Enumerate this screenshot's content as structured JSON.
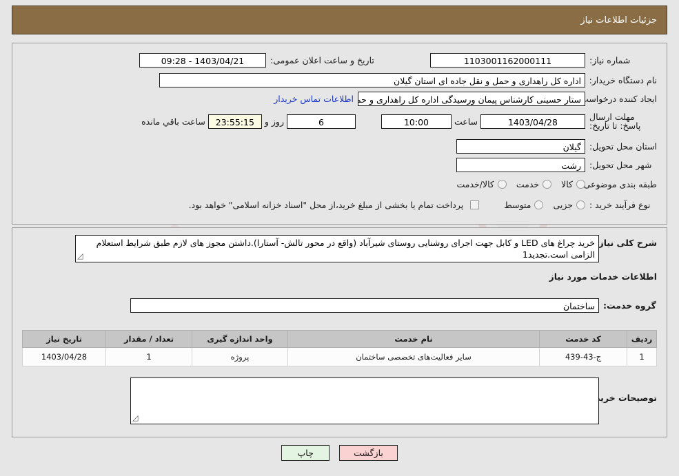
{
  "header": {
    "title": "جزئیات اطلاعات نیاز"
  },
  "watermark": {
    "text": "AriaTender.net"
  },
  "form": {
    "need_number": {
      "label": "شماره نیاز:",
      "value": "1103001162000111"
    },
    "announce_datetime": {
      "label": "تاریخ و ساعت اعلان عمومی:",
      "value": "1403/04/21 - 09:28"
    },
    "buyer_org": {
      "label": "نام دستگاه خریدار:",
      "value": "اداره کل راهداری و حمل و نقل جاده ای استان گیلان"
    },
    "requester": {
      "label": "ایجاد کننده درخواست:",
      "value": "ستار حسینی کارشناس پیمان ورسیدگی اداره کل راهداری و حمل و نقل جاده ای",
      "contact_link": "اطلاعات تماس خریدار"
    },
    "deadline": {
      "label": "مهلت ارسال پاسخ: تا تاریخ:",
      "date": "1403/04/28",
      "time_label": "ساعت",
      "time": "10:00",
      "days": "6",
      "days_label": "روز و",
      "countdown": "23:55:15",
      "countdown_label": "ساعت باقي مانده"
    },
    "delivery_province": {
      "label": "استان محل تحویل:",
      "value": "گیلان"
    },
    "delivery_city": {
      "label": "شهر محل تحویل:",
      "value": "رشت"
    },
    "subject_class": {
      "label": "طبقه بندی موضوعی:",
      "options": [
        {
          "label": "کالا",
          "selected": false
        },
        {
          "label": "خدمت",
          "selected": false
        },
        {
          "label": "کالا/خدمت",
          "selected": false
        }
      ]
    },
    "process_type": {
      "label": "نوع فرآیند خرید :",
      "options": [
        {
          "label": "جزیی",
          "selected": false
        },
        {
          "label": "متوسط",
          "selected": false
        }
      ],
      "treasury_checkbox": {
        "checked": false
      },
      "treasury_text": "پرداخت تمام یا بخشی از مبلغ خرید،از محل \"اسناد خزانه اسلامی\" خواهد بود."
    }
  },
  "description": {
    "label": "شرح کلی نیاز:",
    "value": "خرید چراغ های  LED و کابل جهت اجرای روشنایی روستای شیرآباد (واقع در محور تالش- آستارا).داشتن مجوز های لازم طبق شرایط استعلام الزامی است.تجدید1"
  },
  "services_section": {
    "heading": "اطلاعات خدمات مورد نیاز",
    "group_label": "گروه خدمت:",
    "group_value": "ساختمان"
  },
  "table": {
    "columns": [
      "ردیف",
      "کد خدمت",
      "نام خدمت",
      "واحد اندازه گیری",
      "تعداد / مقدار",
      "تاریخ نیاز"
    ],
    "rows": [
      {
        "row": "1",
        "service_code": "ج-43-439",
        "service_name": "سایر فعالیت‌های تخصصی ساختمان",
        "unit": "پروژه",
        "quantity": "1",
        "need_date": "1403/04/28"
      }
    ]
  },
  "buyer_comments": {
    "label": "توصیحات خریدار;",
    "value": ""
  },
  "buttons": {
    "print": "چاپ",
    "back": "بازگشت"
  },
  "colors": {
    "header_bg": "#8a6d45",
    "link": "#1c36c9",
    "countdown_bg": "#fbfae2",
    "print_bg": "#e4f4e2",
    "back_bg": "#fbd2d2",
    "table_header_bg": "#c6c6c6"
  }
}
